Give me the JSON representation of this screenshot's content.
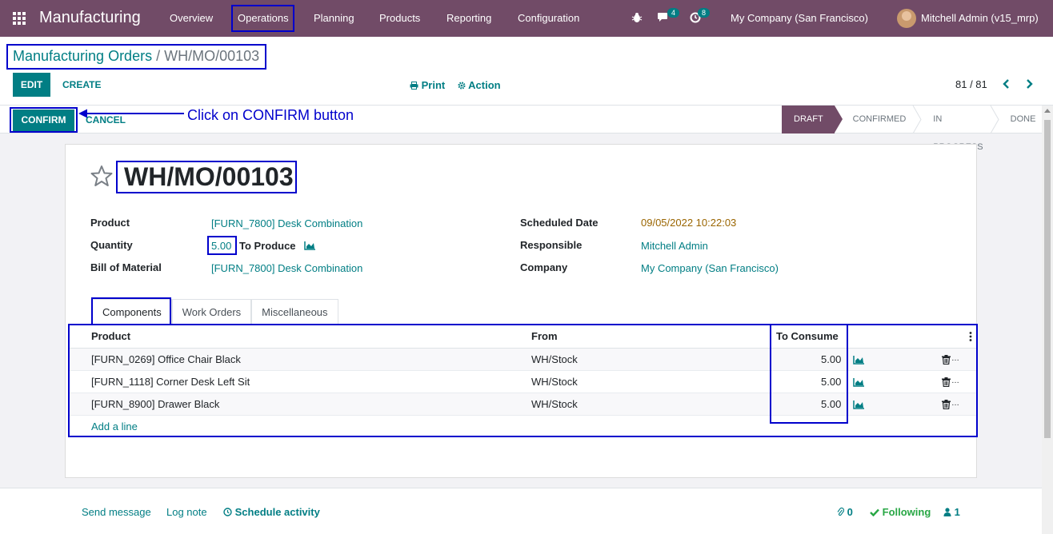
{
  "navbar": {
    "app_name": "Manufacturing",
    "menus": [
      "Overview",
      "Operations",
      "Planning",
      "Products",
      "Reporting",
      "Configuration"
    ],
    "chat_badge": "4",
    "activity_badge": "8",
    "company": "My Company (San Francisco)",
    "user": "Mitchell Admin (v15_mrp)"
  },
  "breadcrumb": {
    "parent": "Manufacturing Orders",
    "separator": "/",
    "current": "WH/MO/00103"
  },
  "toolbar": {
    "edit_label": "EDIT",
    "create_label": "CREATE",
    "print_label": "Print",
    "action_label": "Action",
    "pager": "81 / 81"
  },
  "statusbar": {
    "confirm_label": "CONFIRM",
    "cancel_label": "CANCEL",
    "stages": [
      "DRAFT",
      "CONFIRMED",
      "IN PROGRESS",
      "DONE"
    ],
    "active_stage": "DRAFT"
  },
  "annotation": {
    "text": "Click on CONFIRM button"
  },
  "form": {
    "title": "WH/MO/00103",
    "product_label": "Product",
    "product_value": "[FURN_7800] Desk Combination",
    "quantity_label": "Quantity",
    "quantity_value": "5.00",
    "to_produce_label": "To Produce",
    "bom_label": "Bill of Material",
    "bom_value": "[FURN_7800] Desk Combination",
    "scheduled_label": "Scheduled Date",
    "scheduled_value": "09/05/2022 10:22:03",
    "responsible_label": "Responsible",
    "responsible_value": "Mitchell Admin",
    "company_label": "Company",
    "company_value": "My Company (San Francisco)"
  },
  "tabs": [
    "Components",
    "Work Orders",
    "Miscellaneous"
  ],
  "table": {
    "headers": [
      "Product",
      "From",
      "To Consume"
    ],
    "rows": [
      {
        "product": "[FURN_0269] Office Chair Black",
        "from": "WH/Stock",
        "to_consume": "5.00"
      },
      {
        "product": "[FURN_1118] Corner Desk Left Sit",
        "from": "WH/Stock",
        "to_consume": "5.00"
      },
      {
        "product": "[FURN_8900] Drawer Black",
        "from": "WH/Stock",
        "to_consume": "5.00"
      }
    ],
    "add_line": "Add a line"
  },
  "chatter": {
    "send_message": "Send message",
    "log_note": "Log note",
    "schedule_activity": "Schedule activity",
    "attachments_count": "0",
    "following_label": "Following",
    "followers_count": "1"
  },
  "colors": {
    "brand": "#714b67",
    "accent": "#017e84",
    "annotation": "#0000cc"
  }
}
